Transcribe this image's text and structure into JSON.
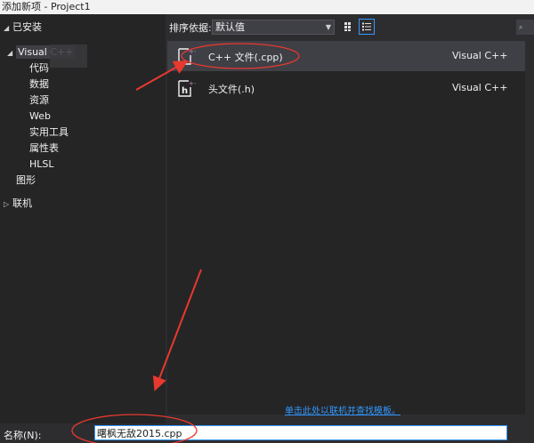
{
  "window": {
    "title": "添加新项 - Project1"
  },
  "tree": {
    "installed_label": "已安装",
    "items": [
      {
        "label": "Visual C++"
      },
      {
        "label": "代码"
      },
      {
        "label": "数据"
      },
      {
        "label": "资源"
      },
      {
        "label": "Web"
      },
      {
        "label": "实用工具"
      },
      {
        "label": "属性表"
      },
      {
        "label": "HLSL"
      },
      {
        "label": "图形"
      }
    ],
    "online_label": "联机"
  },
  "toolbar": {
    "sort_label": "排序依据:",
    "sort_value": "默认值"
  },
  "templates": [
    {
      "name": "C++ 文件(.cpp)",
      "language": "Visual C++",
      "icon": "cpp-file-icon"
    },
    {
      "name": "头文件(.h)",
      "language": "Visual C++",
      "icon": "header-file-icon"
    }
  ],
  "online_link": "单击此处以联机并查找模板。",
  "name_field": {
    "label": "名称(N):",
    "value": "曙枫无敌2015.cpp"
  },
  "colors": {
    "background": "#2d2d30",
    "panel": "#252526",
    "selection": "#3f3f46",
    "accent": "#3399ff",
    "annotation": "#e8392f"
  }
}
